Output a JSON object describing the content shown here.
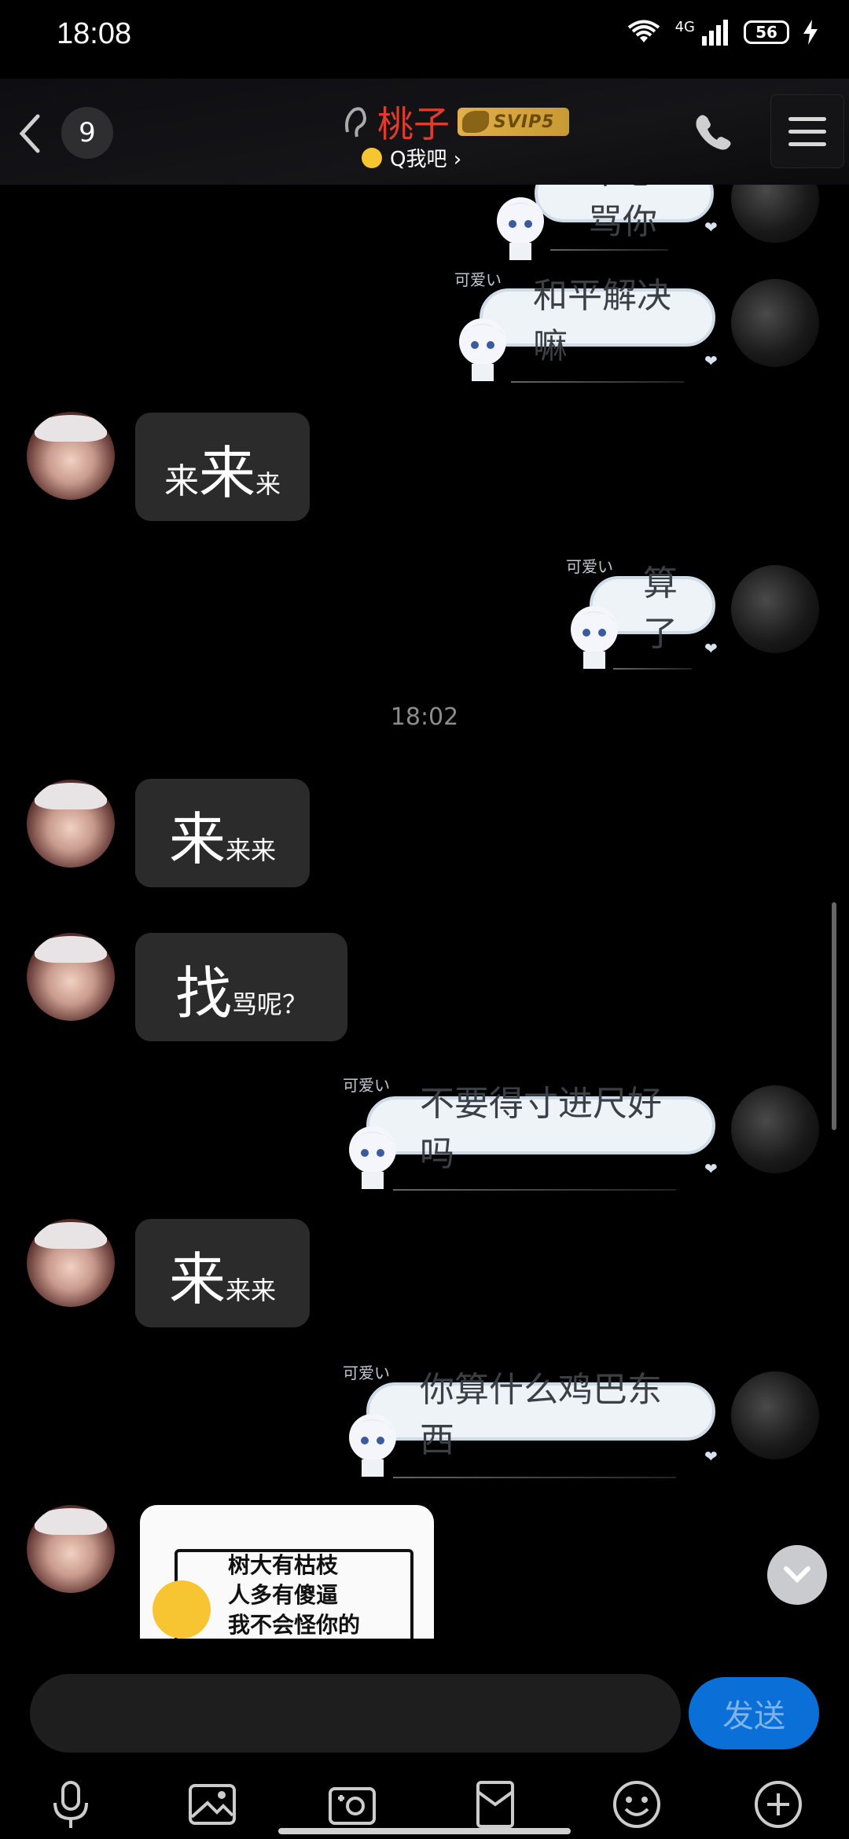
{
  "status": {
    "time": "18:08",
    "network": "4G",
    "battery": "56"
  },
  "header": {
    "unread_count": "9",
    "title": "桃子",
    "vip_badge": "SVIP5",
    "subtitle": "Q我吧 ›"
  },
  "messages": [
    {
      "from": "me",
      "text": "不想骂你",
      "label": ""
    },
    {
      "from": "me",
      "text": "和平解决嘛",
      "label": "可爱い"
    },
    {
      "from": "her",
      "big": "来",
      "pre": "来",
      "post": "来"
    },
    {
      "from": "me",
      "text": "算了",
      "label": "可爱い"
    },
    {
      "from": "system",
      "time": "18:02"
    },
    {
      "from": "her",
      "big": "来",
      "post": "来来"
    },
    {
      "from": "her",
      "big": "找",
      "post": "骂呢？"
    },
    {
      "from": "me",
      "text": "不要得寸进尺好吗",
      "label": "可爱い"
    },
    {
      "from": "her",
      "big": "来",
      "post": "来来"
    },
    {
      "from": "me",
      "text": "你算什么鸡巴东西",
      "label": "可爱い"
    },
    {
      "from": "her",
      "image_lines": [
        "树大有枯枝",
        "人多有傻逼",
        "我不会怪你的"
      ]
    }
  ],
  "input": {
    "placeholder": "",
    "send_label": "发送"
  },
  "toolbar": [
    "mic-icon",
    "image-icon",
    "camera-icon",
    "red-packet-icon",
    "emoji-icon",
    "plus-icon"
  ]
}
